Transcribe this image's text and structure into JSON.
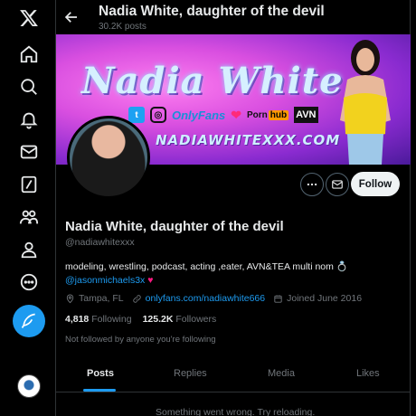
{
  "sidebar": {
    "items": [
      {
        "name": "x-logo-icon"
      },
      {
        "name": "home-icon"
      },
      {
        "name": "explore-icon"
      },
      {
        "name": "notifications-icon"
      },
      {
        "name": "messages-icon"
      },
      {
        "name": "grok-icon"
      },
      {
        "name": "communities-icon"
      },
      {
        "name": "profile-icon"
      },
      {
        "name": "more-icon"
      }
    ],
    "compose_icon": "feather-icon"
  },
  "header": {
    "title": "Nadia White, daughter of the devil",
    "posts_count": "30.2K posts"
  },
  "banner": {
    "title": "Nadia White",
    "logos": {
      "twitter": "t",
      "instagram": "◎",
      "onlyfans": "OnlyFans",
      "pornhub_left": "Porn",
      "pornhub_right": "hub",
      "avn": "AVN"
    },
    "url": "NADIAWHITEXXX.COM"
  },
  "profile": {
    "name": "Nadia White, daughter of the devil",
    "handle": "@nadiawhitexxx",
    "bio_text": "modeling, wrestling, podcast, acting ,eater, AVN&TEA multi nom 💍",
    "bio_mention": "@jasonmichaels3x",
    "bio_emoji": "♥",
    "location": "Tampa, FL",
    "website": "onlyfans.com/nadiawhite666",
    "joined": "Joined June 2016",
    "following_count": "4,818",
    "following_label": "Following",
    "followers_count": "125.2K",
    "followers_label": "Followers",
    "not_followed": "Not followed by anyone you're following",
    "follow_label": "Follow"
  },
  "tabs": [
    {
      "label": "Posts",
      "active": true
    },
    {
      "label": "Replies",
      "active": false
    },
    {
      "label": "Media",
      "active": false
    },
    {
      "label": "Likes",
      "active": false
    }
  ],
  "error_message": "Something went wrong. Try reloading.",
  "colors": {
    "accent": "#1d9bf0",
    "background": "#000000",
    "text": "#e7e9ea",
    "muted": "#71767b"
  }
}
